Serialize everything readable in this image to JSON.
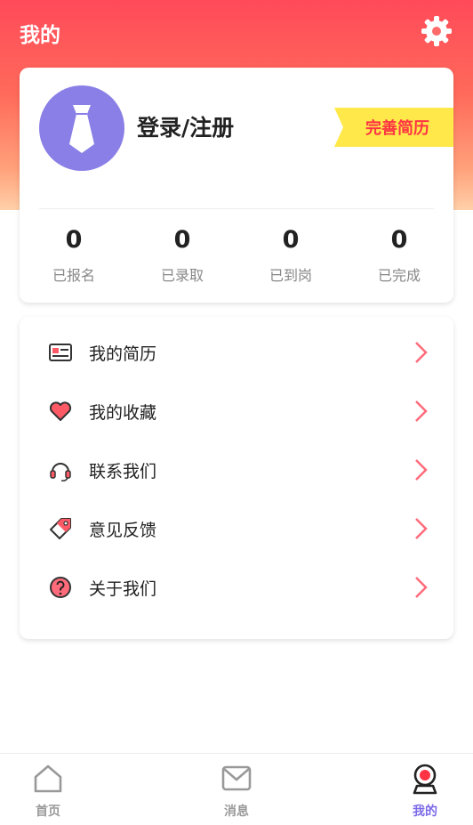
{
  "header": {
    "title": "我的"
  },
  "profile": {
    "login_label": "登录/注册",
    "resume_tag": "完善简历",
    "stats": [
      {
        "value": "0",
        "label": "已报名"
      },
      {
        "value": "0",
        "label": "已录取"
      },
      {
        "value": "0",
        "label": "已到岗"
      },
      {
        "value": "0",
        "label": "已完成"
      }
    ]
  },
  "menu": [
    {
      "label": "我的简历",
      "icon": "resume-card-icon"
    },
    {
      "label": "我的收藏",
      "icon": "heart-icon"
    },
    {
      "label": "联系我们",
      "icon": "headset-icon"
    },
    {
      "label": "意见反馈",
      "icon": "tag-icon"
    },
    {
      "label": "关于我们",
      "icon": "question-icon"
    }
  ],
  "tabs": [
    {
      "label": "首页",
      "icon": "home-icon"
    },
    {
      "label": "消息",
      "icon": "mail-icon"
    },
    {
      "label": "我的",
      "icon": "profile-icon",
      "active": true
    }
  ],
  "colors": {
    "accent": "#ff4a5a",
    "avatar": "#8a7fe6",
    "active_tab": "#7c6ae8",
    "tag_bg": "#ffe84a"
  }
}
